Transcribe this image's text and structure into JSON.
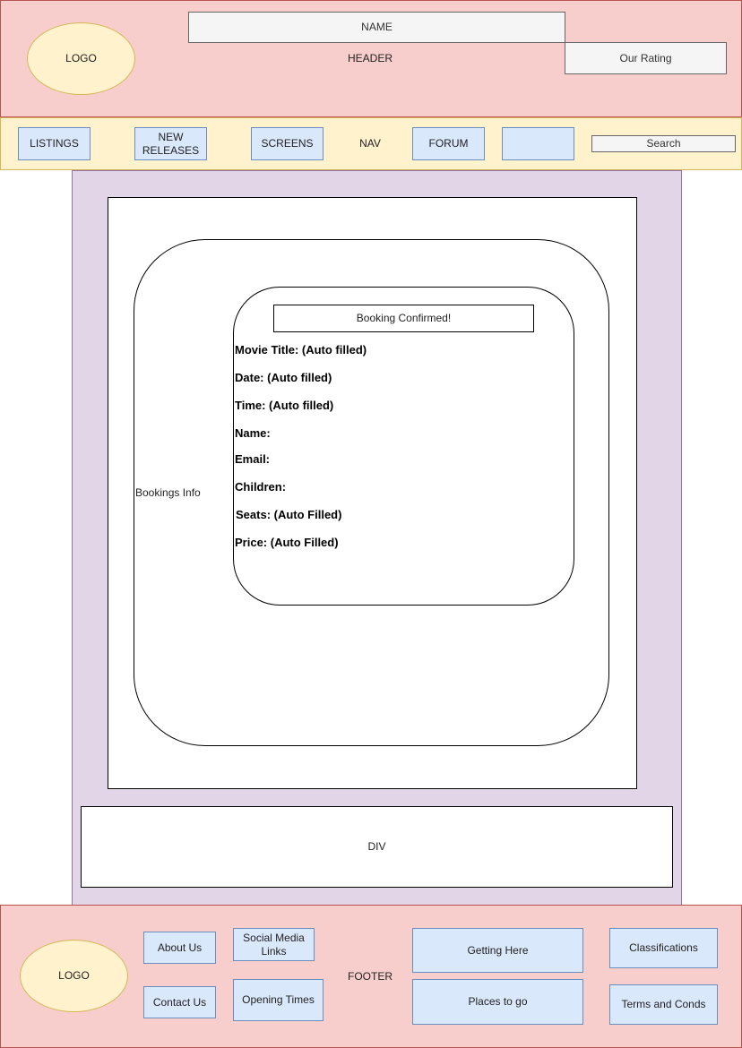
{
  "header": {
    "label": "HEADER",
    "logo": "LOGO",
    "name": "NAME",
    "rating": "Our Rating"
  },
  "nav": {
    "label": "NAV",
    "items": [
      "LISTINGS",
      "NEW\nRELEASES",
      "SCREENS",
      "FORUM",
      ""
    ],
    "search": "Search"
  },
  "main": {
    "bookings_info": "Bookings Info",
    "confirmation": "Booking Confirmed!",
    "fields": [
      "Movie Title: (Auto filled)",
      "Date: (Auto filled)",
      "Time: (Auto filled)",
      "Name:",
      "Email:",
      "Children:",
      "Seats: (Auto Filled)",
      "Price: (Auto Filled)"
    ],
    "div_label": "DIV"
  },
  "footer": {
    "label": "FOOTER",
    "logo": "LOGO",
    "about": "About Us",
    "contact": "Contact Us",
    "social": "Social Media Links",
    "opening": "Opening Times",
    "getting_here": "Getting Here",
    "places": "Places to go",
    "classifications": "Classifications",
    "terms": "Terms and Conds"
  }
}
